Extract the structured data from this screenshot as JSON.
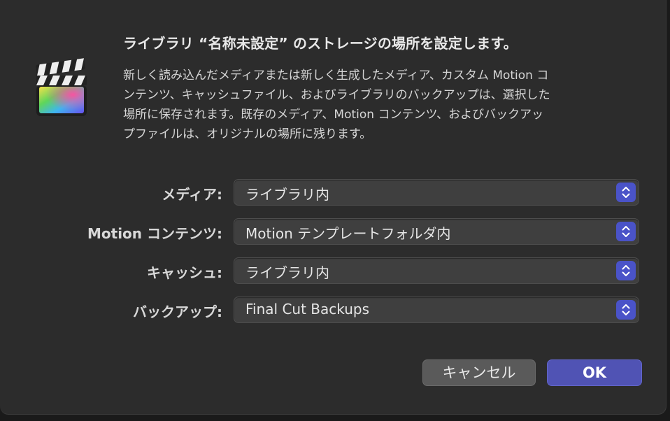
{
  "dialog": {
    "title": "ライブラリ “名称未設定” のストレージの場所を設定します。",
    "message_lines": [
      "新しく読み込んだメディアまたは新しく生成したメディア、カスタム Motion コ",
      "ンテンツ、キャッシュファイル、およびライブラリのバックアップは、選択した",
      "場所に保存されます。既存のメディア、Motion コンテンツ、およびバックアッ",
      "プファイルは、オリジナルの場所に残ります。"
    ],
    "app_icon": "final-cut-pro-clapperboard-icon"
  },
  "settings": [
    {
      "label": "メディア:",
      "value": "ライブラリ内"
    },
    {
      "label": "Motion コンテンツ:",
      "value": "Motion テンプレートフォルダ内"
    },
    {
      "label": "キャッシュ:",
      "value": "ライブラリ内"
    },
    {
      "label": "バックアップ:",
      "value": "Final Cut Backups"
    }
  ],
  "buttons": {
    "cancel": "キャンセル",
    "ok": "OK"
  },
  "colors": {
    "accent": "#5053b4",
    "stepper": "#4a53c8",
    "dialog_bg": "#2c2c2c"
  }
}
